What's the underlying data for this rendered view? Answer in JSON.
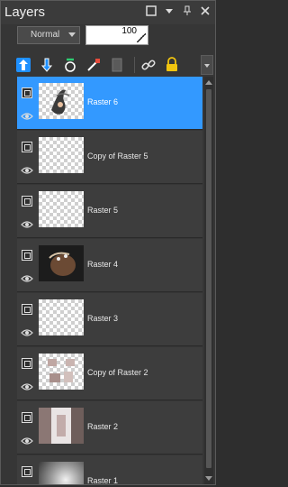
{
  "panel": {
    "title": "Layers"
  },
  "titlebar_icons": [
    "maximize-icon",
    "close-panel-icon",
    "pin-icon",
    "close-icon"
  ],
  "blend": {
    "mode": "Normal",
    "opacity": "100"
  },
  "toolbar": {
    "tools": [
      "new-raster-layer-icon",
      "new-vector-layer-icon",
      "mask-icon",
      "adjustment-layer-icon",
      "delete-layer-icon",
      "link-icon",
      "lock-icon"
    ]
  },
  "layers": [
    {
      "name": "Raster 6",
      "selected": true,
      "thumb": "ornament"
    },
    {
      "name": "Copy of Raster 5",
      "selected": false,
      "thumb": "empty"
    },
    {
      "name": "Raster 5",
      "selected": false,
      "thumb": "empty"
    },
    {
      "name": "Raster 4",
      "selected": false,
      "thumb": "dark-portrait"
    },
    {
      "name": "Raster 3",
      "selected": false,
      "thumb": "empty"
    },
    {
      "name": "Copy of Raster 2",
      "selected": false,
      "thumb": "tiles"
    },
    {
      "name": "Raster 2",
      "selected": false,
      "thumb": "blocks"
    },
    {
      "name": "Raster 1",
      "selected": false,
      "thumb": "gradient"
    }
  ],
  "colors": {
    "selection": "#3399ff",
    "panel": "#363636",
    "row": "#3d3d3d"
  }
}
